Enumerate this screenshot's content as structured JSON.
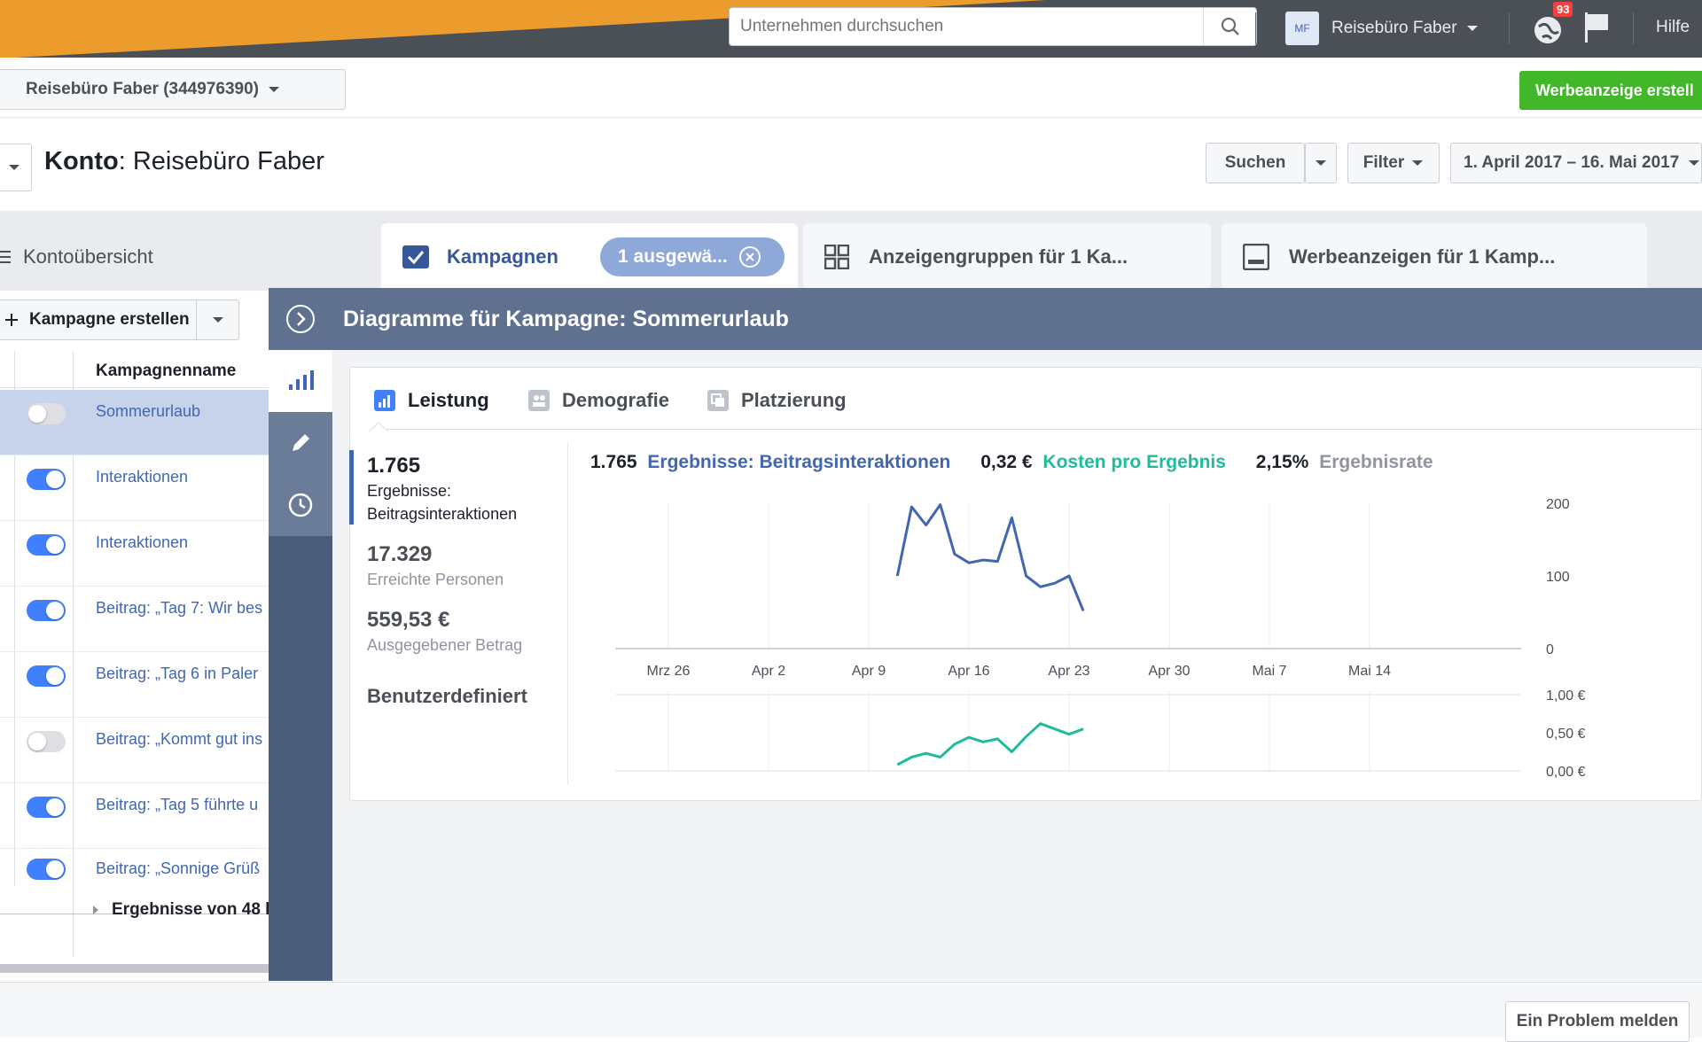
{
  "topbar": {
    "search_placeholder": "Unternehmen durchsuchen",
    "account_initials": "MF",
    "account_name": "Reisebüro Faber",
    "notification_count": "93",
    "help_label": "Hilfe"
  },
  "subbar": {
    "account_select": "Reisebüro Faber (344976390)",
    "create_ad_label": "Werbeanzeige erstell"
  },
  "header": {
    "konto_label": "Konto",
    "konto_name": ": Reisebüro Faber",
    "search_label": "Suchen",
    "filter_label": "Filter",
    "date_range": "1. April 2017 – 16. Mai 2017"
  },
  "tabs": {
    "overview": "Kontoübersicht",
    "campaigns": "Kampagnen",
    "selected_pill": "1 ausgewä...",
    "adsets": "Anzeigengruppen für 1 Ka...",
    "ads": "Werbeanzeigen für 1 Kamp..."
  },
  "campaign_list": {
    "create_label": "Kampagne erstellen",
    "column_name": "Kampagnenname",
    "rows": [
      {
        "name": "Sommerurlaub",
        "on": false
      },
      {
        "name": "Interaktionen",
        "on": true
      },
      {
        "name": "Interaktionen",
        "on": true
      },
      {
        "name": "Beitrag: „Tag 7: Wir bes",
        "on": true
      },
      {
        "name": "Beitrag: „Tag 6 in Paler",
        "on": true
      },
      {
        "name": "Beitrag: „Kommt gut ins",
        "on": false
      },
      {
        "name": "Beitrag: „Tag 5 führte u",
        "on": true
      },
      {
        "name": "Beitrag: „Sonnige Grüß",
        "on": true
      }
    ],
    "results_label": "Ergebnisse von 48 l"
  },
  "panel": {
    "title": "Diagramme für Kampagne: Sommerurlaub",
    "tabs": [
      "Leistung",
      "Demografie",
      "Platzierung"
    ],
    "metrics": [
      {
        "value": "1.765",
        "label1": "Ergebnisse:",
        "label2": "Beitragsinteraktionen"
      },
      {
        "value": "17.329",
        "label1": "Erreichte Personen"
      },
      {
        "value": "559,53 €",
        "label1": "Ausgegebener Betrag"
      }
    ],
    "custom_label": "Benutzerdefiniert",
    "summary": {
      "results_value": "1.765",
      "results_label": "Ergebnisse: Beitragsinteraktionen",
      "cost_value": "0,32 €",
      "cost_label": "Kosten pro Ergebnis",
      "rate_value": "2,15%",
      "rate_label": "Ergebnisrate"
    }
  },
  "colors": {
    "results_line": "#4267b2",
    "cost_line": "#1fbc9c",
    "accent_green": "#42b72a",
    "rate_text": "#90949c"
  },
  "chart_data": [
    {
      "type": "line",
      "x": [
        "Apr 11",
        "Apr 12",
        "Apr 13",
        "Apr 14",
        "Apr 15",
        "Apr 16",
        "Apr 17",
        "Apr 18",
        "Apr 19",
        "Apr 20",
        "Apr 21",
        "Apr 22",
        "Apr 23",
        "Apr 24"
      ],
      "series": [
        {
          "name": "Ergebnisse: Beitragsinteraktionen",
          "values": [
            100,
            195,
            170,
            198,
            130,
            118,
            122,
            120,
            180,
            100,
            85,
            90,
            100,
            52
          ]
        }
      ],
      "x_tick_labels": [
        "Mrz 26",
        "Apr 2",
        "Apr 9",
        "Apr 16",
        "Apr 23",
        "Apr 30",
        "Mai 7",
        "Mai 14"
      ],
      "y_tick_labels": [
        "200",
        "100",
        "0"
      ],
      "ylim": [
        0,
        200
      ]
    },
    {
      "type": "line",
      "x": [
        "Apr 11",
        "Apr 12",
        "Apr 13",
        "Apr 14",
        "Apr 15",
        "Apr 16",
        "Apr 17",
        "Apr 18",
        "Apr 19",
        "Apr 20",
        "Apr 21",
        "Apr 22",
        "Apr 23",
        "Apr 24"
      ],
      "series": [
        {
          "name": "Kosten pro Ergebnis",
          "values": [
            0.08,
            0.18,
            0.23,
            0.18,
            0.35,
            0.44,
            0.38,
            0.42,
            0.25,
            0.45,
            0.62,
            0.55,
            0.48,
            0.55
          ]
        }
      ],
      "y_tick_labels": [
        "1,00 €",
        "0,50 €",
        "0,00 €"
      ],
      "ylim": [
        0,
        1
      ]
    }
  ],
  "footer": {
    "problem_label": "Ein Problem melden"
  }
}
